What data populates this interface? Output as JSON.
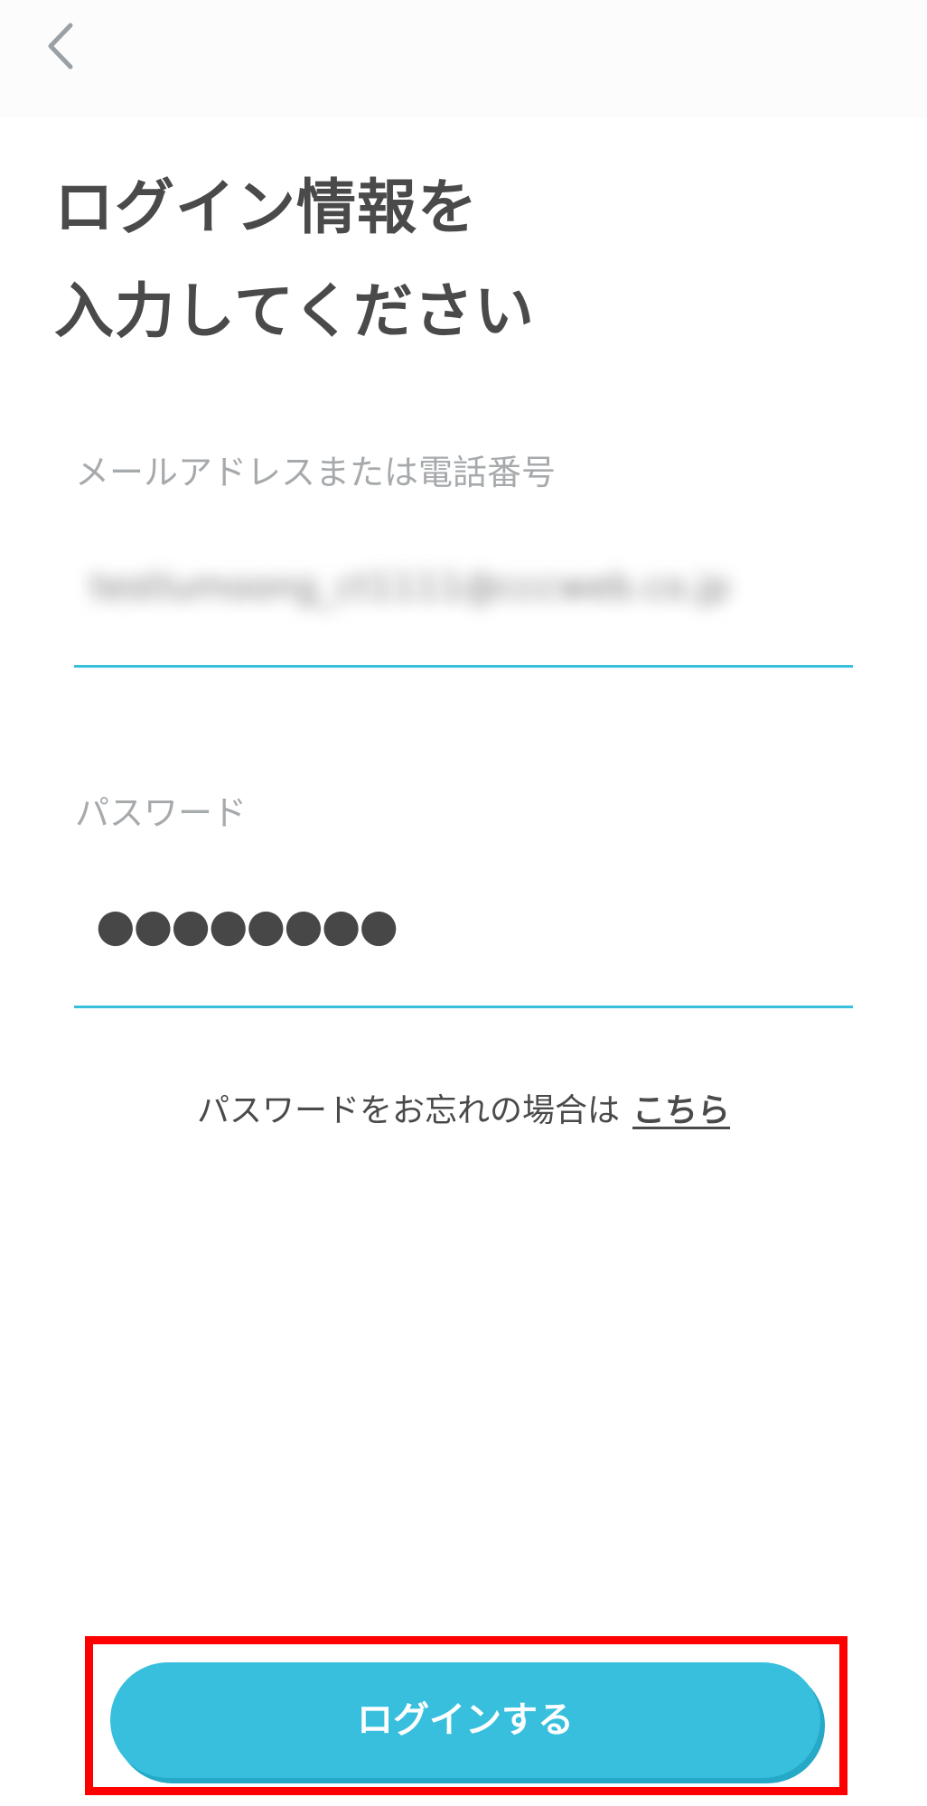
{
  "header": {
    "back_icon": "chevron-left-icon"
  },
  "title": {
    "line1": "ログイン情報を",
    "line2": "入力してください"
  },
  "email_field": {
    "label": "メールアドレスまたは電話番号",
    "value": "testlumoong_ct1111@cccweb.co.jp"
  },
  "password_field": {
    "label": "パスワード",
    "value": "●●●●●●●●"
  },
  "forgot": {
    "text": "パスワードをお忘れの場合は",
    "link": "こちら"
  },
  "login_button": {
    "label": "ログインする"
  },
  "colors": {
    "accent": "#37bfdd",
    "highlight": "#ff0000",
    "text": "#4a4a4a",
    "label": "#a7aaad"
  }
}
